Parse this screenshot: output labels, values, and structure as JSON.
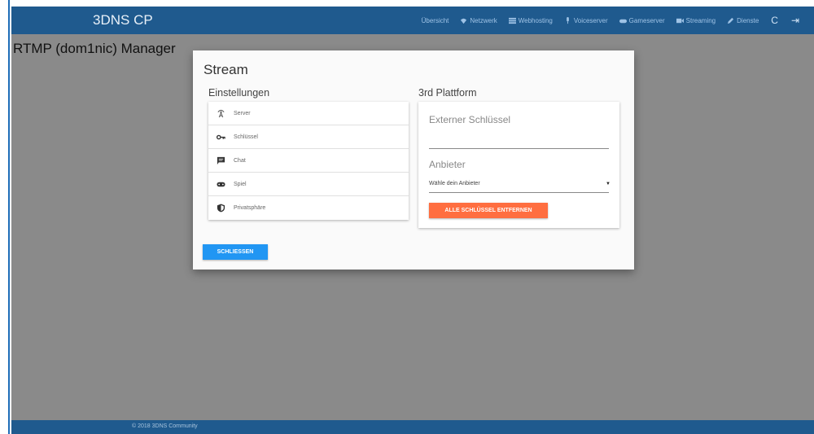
{
  "app": {
    "brand": "3DNS CP",
    "page_title": "RTMP (dom1nic) Manager",
    "footer": "© 2018 3DNS Community"
  },
  "nav": {
    "items": [
      {
        "label": "Übersicht",
        "icon": ""
      },
      {
        "label": "Netzwerk",
        "icon": "wifi-icon"
      },
      {
        "label": "Webhosting",
        "icon": "server-icon"
      },
      {
        "label": "Voiceserver",
        "icon": "microphone-icon"
      },
      {
        "label": "Gameserver",
        "icon": "gamepad-icon"
      },
      {
        "label": "Streaming",
        "icon": "videocam-icon"
      },
      {
        "label": "Dienste",
        "icon": "pencil-icon"
      }
    ],
    "refresh_glyph": "C",
    "logout_glyph": "⇥"
  },
  "modal": {
    "title": "Stream",
    "settings": {
      "title": "Einstellungen",
      "items": [
        {
          "label": "Server",
          "icon": "antenna-icon"
        },
        {
          "label": "Schlüssel",
          "icon": "key-icon"
        },
        {
          "label": "Chat",
          "icon": "chat-icon"
        },
        {
          "label": "Spiel",
          "icon": "gamepad-icon"
        },
        {
          "label": "Privatsphäre",
          "icon": "shield-icon"
        }
      ]
    },
    "platform": {
      "title": "3rd Plattform",
      "external_key_label": "Externer Schlüssel",
      "external_key_value": "",
      "provider_label": "Anbieter",
      "provider_selected": "Wähle dein Anbieter",
      "remove_keys_button": "ALLE SCHLÜSSEL ENTFERNEN"
    },
    "close_button": "SCHLIESSEN"
  },
  "colors": {
    "navbar": "#1f5a8e",
    "overlay": "#8a8a8a",
    "accent_orange": "#ff6e40",
    "accent_blue": "#2196f3"
  }
}
